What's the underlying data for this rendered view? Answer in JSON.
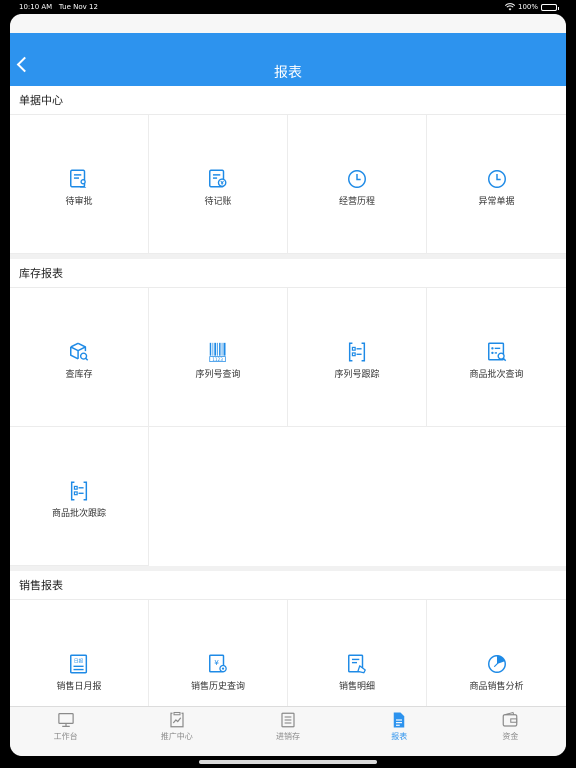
{
  "status": {
    "time": "10:10 AM",
    "date": "Tue Nov 12",
    "battery": "100%"
  },
  "header": {
    "title": "报表"
  },
  "sections": [
    {
      "title": "单据中心",
      "items": [
        "待审批",
        "待记账",
        "经营历程",
        "异常单据"
      ]
    },
    {
      "title": "库存报表",
      "items": [
        "查库存",
        "序列号查询",
        "序列号跟踪",
        "商品批次查询",
        "商品批次跟踪"
      ]
    },
    {
      "title": "销售报表",
      "items": [
        "销售日月报",
        "销售历史查询",
        "销售明细",
        "商品销售分析"
      ]
    }
  ],
  "tabs": [
    "工作台",
    "推广中心",
    "进销存",
    "报表",
    "资金"
  ],
  "active_tab": "报表",
  "colors": {
    "accent": "#2d93ee",
    "icon": "#1e8ae6"
  }
}
